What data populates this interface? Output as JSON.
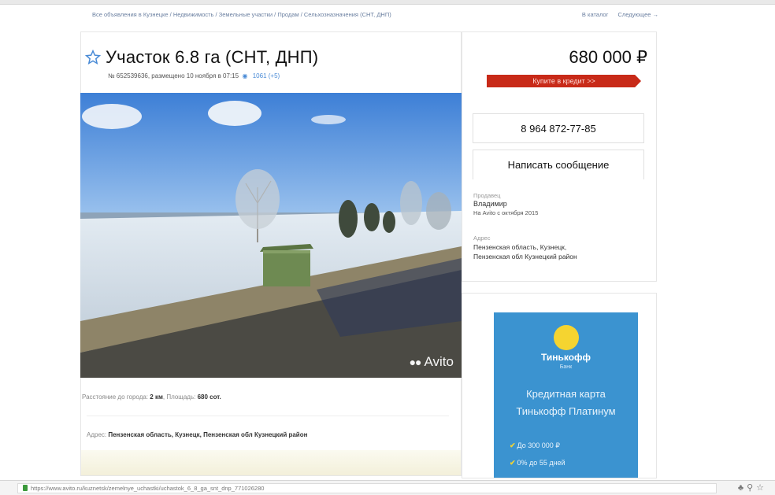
{
  "breadcrumbs": [
    "Все объявления в Кузнецке",
    "Недвижимость",
    "Земельные участки",
    "Продам",
    "Сельхозназначения (СНТ, ДНП)"
  ],
  "topnav": {
    "catalog": "В каталог",
    "next": "Следующее →"
  },
  "listing": {
    "title": "Участок 6.8 га (СНТ, ДНП)",
    "meta": "№ 652539636, размещено 10 ноября в 07:15",
    "views": "1061 (+5)",
    "price": "680 000 ₽",
    "credit_button": "Купите в кредит >>",
    "photo_watermark": "Avito",
    "params_label_distance": "Расстояние до города:",
    "params_distance": "2 км",
    "params_label_area": "Площадь:",
    "params_area": "680 сот.",
    "address_label": "Адрес:",
    "address": "Пензенская область, Кузнецк, Пензенская обл Кузнецкий район"
  },
  "contact": {
    "phone": "8 964 872-77-85",
    "message_button": "Написать сообщение",
    "seller_label": "Продавец",
    "seller_name": "Владимир",
    "seller_since": "На Avito с октября 2015",
    "address_label": "Адрес",
    "address_line1": "Пензенская область, Кузнецк,",
    "address_line2": "Пензенская обл Кузнецкий район"
  },
  "ad": {
    "bank": "Тинькофф",
    "bank_sub": "Банк",
    "offer_line1": "Кредитная карта",
    "offer_line2": "Тинькофф Платинум",
    "feature1": "До 300 000 ₽",
    "feature2": "0% до 55 дней"
  },
  "statusbar": {
    "url": "https://www.avito.ru/kuznetsk/zemelnye_uchastki/uchastok_6_8_ga_snt_dnp_771026280"
  },
  "colors": {
    "accent_blue": "#3b93d0",
    "credit_red": "#c82a18",
    "link": "#4a8bd6"
  }
}
